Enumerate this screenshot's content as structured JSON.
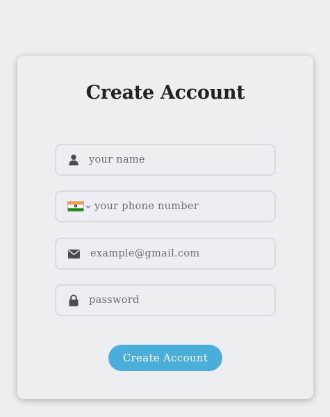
{
  "form": {
    "title": "Create Account",
    "fields": {
      "name": {
        "placeholder": "your name",
        "icon": "user-icon"
      },
      "phone": {
        "placeholder": "your phone number",
        "icon": "india-flag-icon",
        "country_selector_icon": "chevron-down-icon"
      },
      "email": {
        "placeholder": "example@gmail.com",
        "icon": "envelope-icon"
      },
      "password": {
        "placeholder": "password",
        "icon": "lock-icon"
      }
    },
    "submit_label": "Create Account"
  },
  "colors": {
    "background": "#eceef1",
    "accent": "#4aaedb",
    "title": "#222222",
    "field_border": "#d8dce1"
  }
}
